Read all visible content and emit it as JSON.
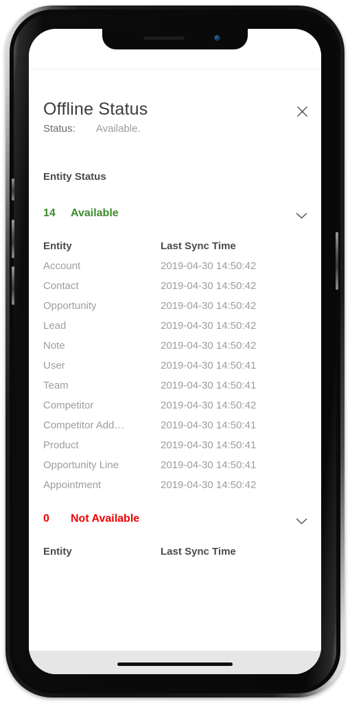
{
  "device": {
    "frame": "iphone-x",
    "notch_icons": [
      "speaker-slot",
      "front-camera"
    ],
    "side_buttons": [
      "mute-switch",
      "volume-up",
      "volume-down",
      "power"
    ]
  },
  "dialog": {
    "title": "Offline Status",
    "close_icon": "close-icon"
  },
  "status": {
    "label": "Status:",
    "value": "Available."
  },
  "entity_status": {
    "heading": "Entity Status",
    "columns": {
      "entity": "Entity",
      "last_sync_time": "Last Sync Time"
    },
    "sections": [
      {
        "id": "available",
        "count": "14",
        "label": "Available",
        "color": "#3d8b2c",
        "chevron_icon": "chevron-down-icon",
        "expanded": true,
        "rows": [
          {
            "entity": "Account",
            "last_sync_time": "2019-04-30 14:50:42"
          },
          {
            "entity": "Contact",
            "last_sync_time": "2019-04-30 14:50:42"
          },
          {
            "entity": "Opportunity",
            "last_sync_time": "2019-04-30 14:50:42"
          },
          {
            "entity": "Lead",
            "last_sync_time": "2019-04-30 14:50:42"
          },
          {
            "entity": "Note",
            "last_sync_time": "2019-04-30 14:50:42"
          },
          {
            "entity": "User",
            "last_sync_time": "2019-04-30 14:50:41"
          },
          {
            "entity": "Team",
            "last_sync_time": "2019-04-30 14:50:41"
          },
          {
            "entity": "Competitor",
            "last_sync_time": "2019-04-30 14:50:42"
          },
          {
            "entity": "Competitor Add…",
            "last_sync_time": "2019-04-30 14:50:41"
          },
          {
            "entity": "Product",
            "last_sync_time": "2019-04-30 14:50:41"
          },
          {
            "entity": "Opportunity Line",
            "last_sync_time": "2019-04-30 14:50:41"
          },
          {
            "entity": "Appointment",
            "last_sync_time": "2019-04-30 14:50:42"
          }
        ]
      },
      {
        "id": "not-available",
        "count": "0",
        "label": "Not Available",
        "color": "#ef0000",
        "chevron_icon": "chevron-down-icon",
        "expanded": true,
        "rows": []
      }
    ]
  }
}
